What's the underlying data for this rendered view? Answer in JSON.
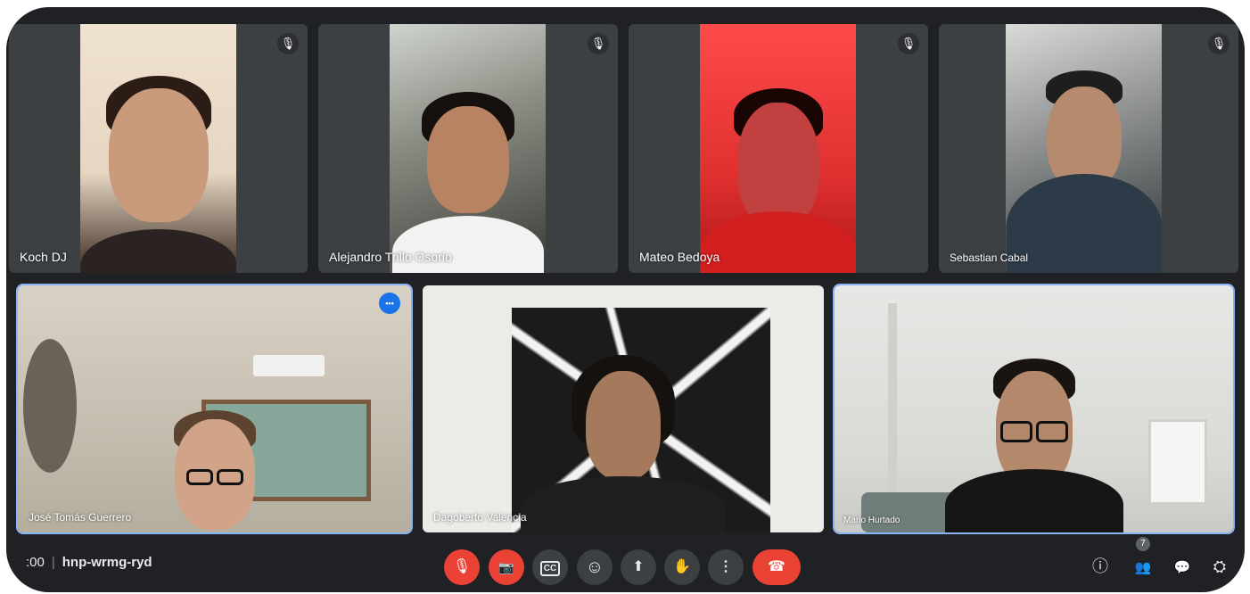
{
  "meeting": {
    "time": ":00",
    "code": "hnp-wrmg-ryd"
  },
  "participants": [
    {
      "name": "Koch DJ",
      "muted": true
    },
    {
      "name": "Alejandro Trillo Osorio",
      "muted": true
    },
    {
      "name": "Mateo Bedoya",
      "muted": true
    },
    {
      "name": "Sebastian Cabal",
      "muted": true
    },
    {
      "name": "José Tomás Guerrero",
      "pinned_menu": true
    },
    {
      "name": "Dagoberto Valencia"
    },
    {
      "name": "Mario Hurtado"
    }
  ],
  "icons": {
    "mic_off": "🎙",
    "more": "•••",
    "cam_off": "📷",
    "captions": "CC",
    "emoji": "☺",
    "present": "⬆",
    "hand": "✋",
    "menu": "⋮",
    "hangup": "☎",
    "info": "ⓘ",
    "people": "👥",
    "chat": "💬",
    "activities": "⛭"
  },
  "people_count": "7",
  "colors": {
    "accent": "#8ab4f8",
    "danger": "#ea4335",
    "bar_bg": "#202124",
    "tile_bg": "#3c4043"
  }
}
